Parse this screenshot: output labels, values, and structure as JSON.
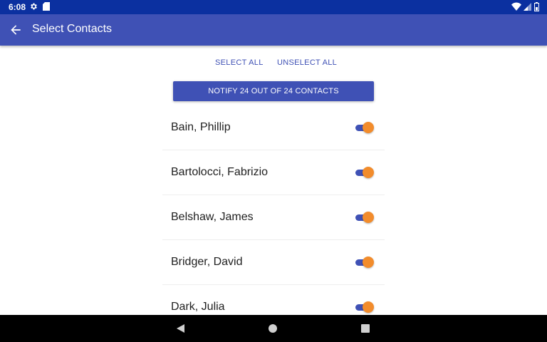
{
  "status_bar": {
    "time": "6:08",
    "icons": [
      "gear-icon",
      "sd-card-icon",
      "wifi-icon",
      "signal-icon",
      "battery-icon"
    ]
  },
  "app_bar": {
    "title": "Select Contacts",
    "back_icon": "arrow-left-icon"
  },
  "actions": {
    "select_all": "SELECT ALL",
    "unselect_all": "UNSELECT ALL",
    "notify": "NOTIFY 24 OUT OF 24 CONTACTS"
  },
  "contacts": [
    {
      "name": "Bain, Phillip",
      "selected": true
    },
    {
      "name": "Bartolocci, Fabrizio",
      "selected": true
    },
    {
      "name": "Belshaw, James",
      "selected": true
    },
    {
      "name": "Bridger, David",
      "selected": true
    },
    {
      "name": "Dark, Julia",
      "selected": true
    }
  ],
  "colors": {
    "primary": "#3f51b5",
    "status_bar": "#0b30a0",
    "accent": "#f28c2c"
  },
  "nav_bar": {
    "icons": [
      "back-triangle-icon",
      "home-circle-icon",
      "recents-square-icon"
    ]
  }
}
